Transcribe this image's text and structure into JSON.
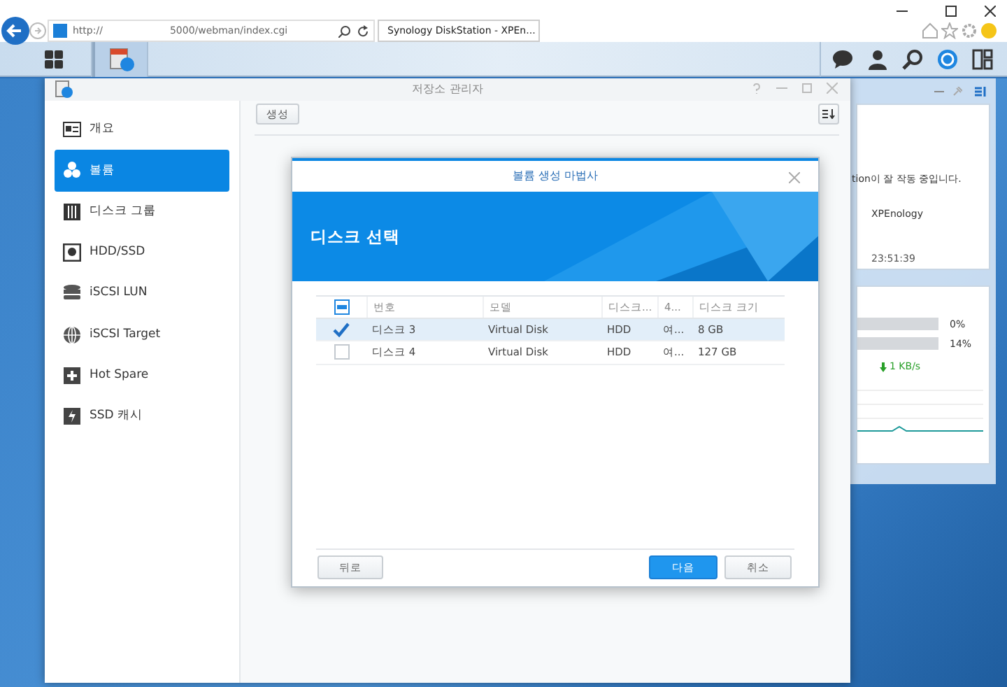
{
  "browser": {
    "address_prefix": "http://",
    "address_path": "5000/webman/index.cgi",
    "tab_title": "Synology DiskStation - XPEn..."
  },
  "storage_manager": {
    "title": "저장소 관리자",
    "create_button": "생성",
    "sidebar": [
      {
        "label": "개요",
        "selected": false
      },
      {
        "label": "볼륨",
        "selected": true
      },
      {
        "label": "디스크 그룹",
        "selected": false
      },
      {
        "label": "HDD/SSD",
        "selected": false
      },
      {
        "label": "iSCSI LUN",
        "selected": false
      },
      {
        "label": "iSCSI Target",
        "selected": false
      },
      {
        "label": "Hot Spare",
        "selected": false
      },
      {
        "label": "SSD 캐시",
        "selected": false
      }
    ]
  },
  "wizard": {
    "title": "볼륨 생성 마법사",
    "step": "디스크 선택",
    "header_checkbox_partial": true,
    "columns": [
      "번호",
      "모델",
      "디스크...",
      "4...",
      "디스크 크기"
    ],
    "rows": [
      {
        "selected": true,
        "checked": true,
        "cells": [
          "디스크 3",
          "Virtual Disk",
          "HDD",
          "여...",
          "8 GB"
        ]
      },
      {
        "selected": false,
        "checked": false,
        "cells": [
          "디스크 4",
          "Virtual Disk",
          "HDD",
          "여...",
          "127 GB"
        ]
      }
    ],
    "buttons": [
      {
        "label": "뒤로",
        "kind": "default"
      },
      {
        "label": "다음",
        "kind": "primary"
      },
      {
        "label": "취소",
        "kind": "default"
      }
    ]
  },
  "widget": {
    "status_text": "tion이 잘 작동 중입니다.",
    "server_name": "XPEnology",
    "time": "23:51:39",
    "meters": [
      {
        "reading": "0%"
      },
      {
        "reading": "14%"
      }
    ],
    "download_speed": "1 KB/s"
  }
}
